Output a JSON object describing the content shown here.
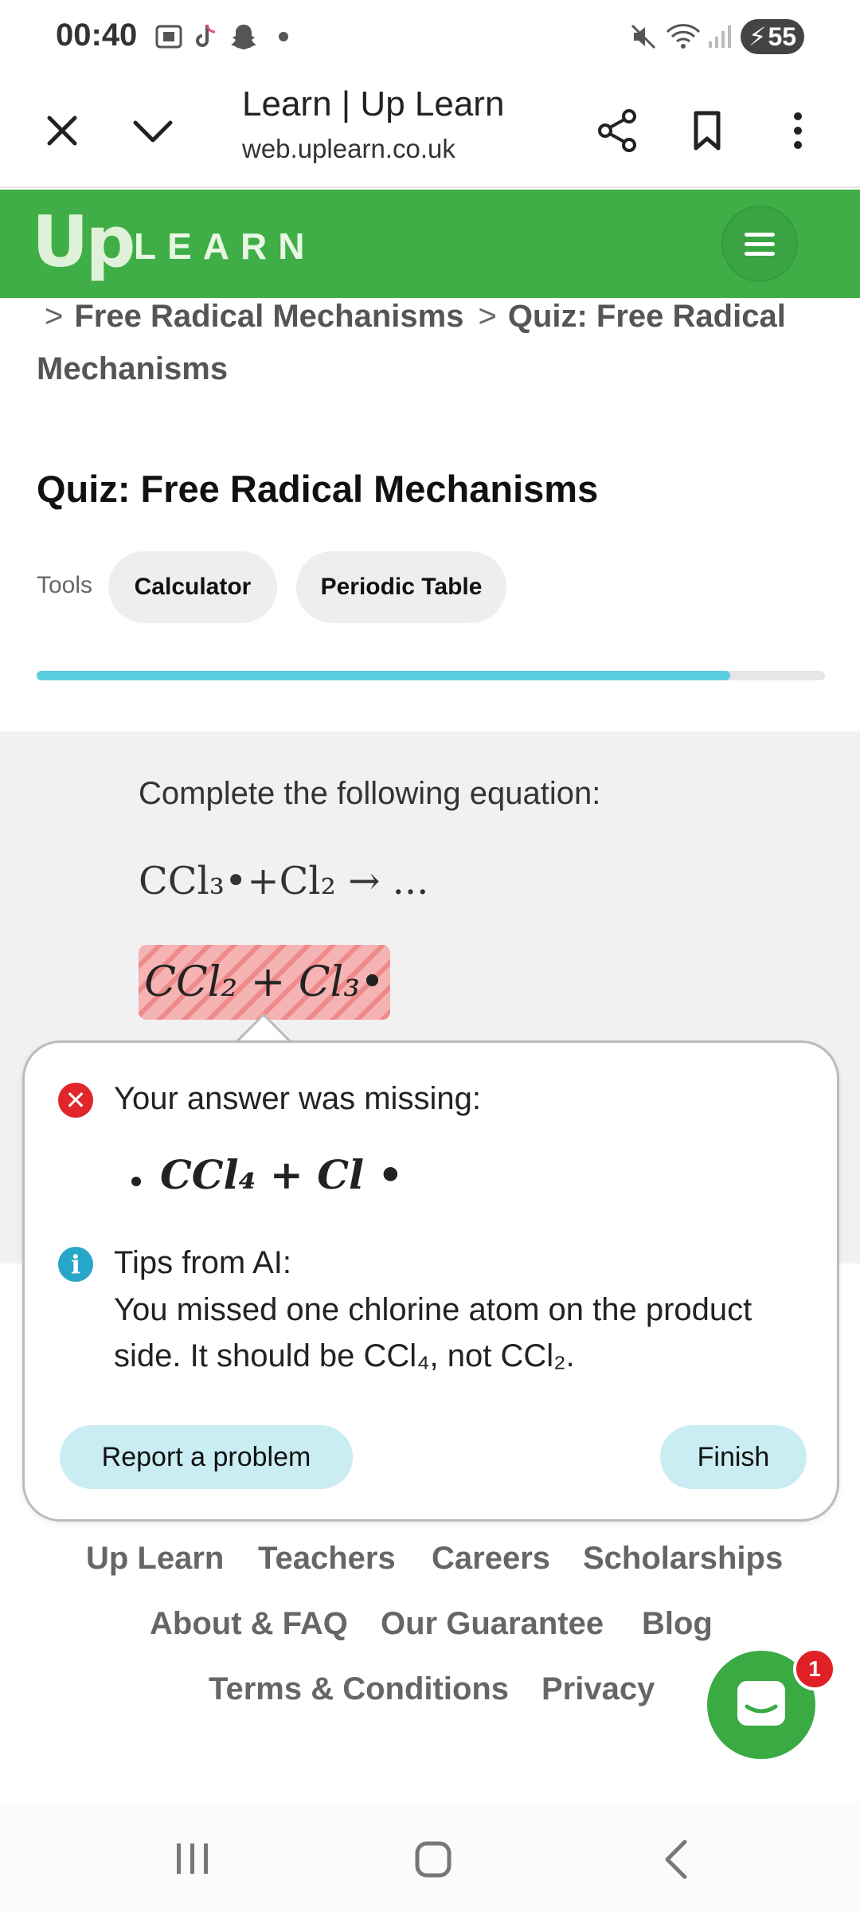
{
  "status_bar": {
    "time": "00:40",
    "battery_level": "55",
    "icons": [
      "screenshot-icon",
      "tiktok-icon",
      "snapchat-icon",
      "dot-icon",
      "mute-icon",
      "wifi-icon",
      "signal-icon",
      "battery-charging-icon"
    ]
  },
  "browser": {
    "title": "Learn | Up Learn",
    "url": "web.uplearn.co.uk"
  },
  "site_header": {
    "logo_up": "Up",
    "logo_learn": "LEARN",
    "brand_color": "#3fae47"
  },
  "breadcrumb": {
    "items": [
      "Free Radical Mechanisms",
      "Quiz: Free Radical Mechanisms"
    ]
  },
  "quiz": {
    "title": "Quiz: Free Radical Mechanisms",
    "tools_label": "Tools",
    "tools": [
      "Calculator",
      "Periodic Table"
    ],
    "progress_percent": 88,
    "progress_color": "#5bcde0"
  },
  "question": {
    "prompt": "Complete the following equation:",
    "equation": "CCl₃•+Cl₂ → ...",
    "user_answer": "CCl₂ + Cl₃•"
  },
  "feedback": {
    "missing_label": "Your answer was missing:",
    "missing_items": [
      "CCl₄ + Cl •"
    ],
    "tips_label": "Tips from AI:",
    "tips_text": "You missed one chlorine atom on the product side. It should be CCl₄, not CCl₂.",
    "report_button": "Report a problem",
    "finish_button": "Finish"
  },
  "footer": {
    "links": [
      "Up Learn",
      "Teachers",
      "Careers",
      "Scholarships",
      "About & FAQ",
      "Our Guarantee",
      "Blog",
      "Terms & Conditions",
      "Privacy"
    ]
  },
  "chat": {
    "badge_count": "1"
  }
}
